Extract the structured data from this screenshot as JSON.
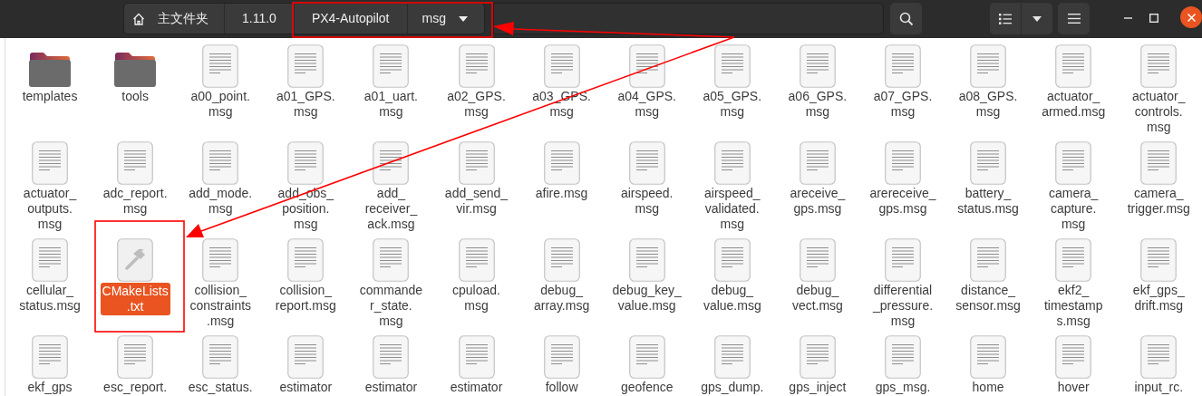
{
  "toolbar": {
    "breadcrumbs": [
      {
        "label": "主文件夹",
        "kind": "home"
      },
      {
        "label": "1.11.0",
        "kind": "plain"
      },
      {
        "label": "PX4-Autopilot",
        "kind": "plain"
      },
      {
        "label": "msg",
        "kind": "dropdown"
      }
    ]
  },
  "files": [
    {
      "kind": "folder",
      "lines": [
        "templates"
      ],
      "selected": false
    },
    {
      "kind": "folder",
      "lines": [
        "tools"
      ],
      "selected": false
    },
    {
      "kind": "text",
      "lines": [
        "a00_point.",
        "msg"
      ],
      "selected": false
    },
    {
      "kind": "text",
      "lines": [
        "a01_GPS.",
        "msg"
      ],
      "selected": false
    },
    {
      "kind": "text",
      "lines": [
        "a01_uart.",
        "msg"
      ],
      "selected": false
    },
    {
      "kind": "text",
      "lines": [
        "a02_GPS.",
        "msg"
      ],
      "selected": false
    },
    {
      "kind": "text",
      "lines": [
        "a03_GPS.",
        "msg"
      ],
      "selected": false
    },
    {
      "kind": "text",
      "lines": [
        "a04_GPS.",
        "msg"
      ],
      "selected": false
    },
    {
      "kind": "text",
      "lines": [
        "a05_GPS.",
        "msg"
      ],
      "selected": false
    },
    {
      "kind": "text",
      "lines": [
        "a06_GPS.",
        "msg"
      ],
      "selected": false
    },
    {
      "kind": "text",
      "lines": [
        "a07_GPS.",
        "msg"
      ],
      "selected": false
    },
    {
      "kind": "text",
      "lines": [
        "a08_GPS.",
        "msg"
      ],
      "selected": false
    },
    {
      "kind": "text",
      "lines": [
        "actuator_",
        "armed.msg"
      ],
      "selected": false
    },
    {
      "kind": "text",
      "lines": [
        "actuator_",
        "controls.",
        "msg"
      ],
      "selected": false
    },
    {
      "kind": "text",
      "lines": [
        "actuator_",
        "outputs.",
        "msg"
      ],
      "selected": false
    },
    {
      "kind": "text",
      "lines": [
        "adc_report.",
        "msg"
      ],
      "selected": false
    },
    {
      "kind": "text",
      "lines": [
        "add_mode.",
        "msg"
      ],
      "selected": false
    },
    {
      "kind": "text",
      "lines": [
        "add_obs_",
        "position.",
        "msg"
      ],
      "selected": false
    },
    {
      "kind": "text",
      "lines": [
        "add_",
        "receiver_",
        "ack.msg"
      ],
      "selected": false
    },
    {
      "kind": "text",
      "lines": [
        "add_send_",
        "vir.msg"
      ],
      "selected": false
    },
    {
      "kind": "text",
      "lines": [
        "afire.msg"
      ],
      "selected": false
    },
    {
      "kind": "text",
      "lines": [
        "airspeed.",
        "msg"
      ],
      "selected": false
    },
    {
      "kind": "text",
      "lines": [
        "airspeed_",
        "validated.",
        "msg"
      ],
      "selected": false
    },
    {
      "kind": "text",
      "lines": [
        "areceive_",
        "gps.msg"
      ],
      "selected": false
    },
    {
      "kind": "text",
      "lines": [
        "arereceive_",
        "gps.msg"
      ],
      "selected": false
    },
    {
      "kind": "text",
      "lines": [
        "battery_",
        "status.msg"
      ],
      "selected": false
    },
    {
      "kind": "text",
      "lines": [
        "camera_",
        "capture.",
        "msg"
      ],
      "selected": false
    },
    {
      "kind": "text",
      "lines": [
        "camera_",
        "trigger.msg"
      ],
      "selected": false
    },
    {
      "kind": "text",
      "lines": [
        "cellular_",
        "status.msg"
      ],
      "selected": false
    },
    {
      "kind": "build",
      "lines": [
        "CMakeLists",
        ".txt"
      ],
      "selected": true
    },
    {
      "kind": "text",
      "lines": [
        "collision_",
        "constraints",
        ".msg"
      ],
      "selected": false
    },
    {
      "kind": "text",
      "lines": [
        "collision_",
        "report.msg"
      ],
      "selected": false
    },
    {
      "kind": "text",
      "lines": [
        "commande",
        "r_state.",
        "msg"
      ],
      "selected": false
    },
    {
      "kind": "text",
      "lines": [
        "cpuload.",
        "msg"
      ],
      "selected": false
    },
    {
      "kind": "text",
      "lines": [
        "debug_",
        "array.msg"
      ],
      "selected": false
    },
    {
      "kind": "text",
      "lines": [
        "debug_key_",
        "value.msg"
      ],
      "selected": false
    },
    {
      "kind": "text",
      "lines": [
        "debug_",
        "value.msg"
      ],
      "selected": false
    },
    {
      "kind": "text",
      "lines": [
        "debug_",
        "vect.msg"
      ],
      "selected": false
    },
    {
      "kind": "text",
      "lines": [
        "differential",
        "_pressure.",
        "msg"
      ],
      "selected": false
    },
    {
      "kind": "text",
      "lines": [
        "distance_",
        "sensor.msg"
      ],
      "selected": false
    },
    {
      "kind": "text",
      "lines": [
        "ekf2_",
        "timestamp",
        "s.msg"
      ],
      "selected": false
    },
    {
      "kind": "text",
      "lines": [
        "ekf_gps_",
        "drift.msg"
      ],
      "selected": false
    },
    {
      "kind": "text",
      "lines": [
        "ekf_gps"
      ],
      "selected": false
    },
    {
      "kind": "text",
      "lines": [
        "esc_report."
      ],
      "selected": false
    },
    {
      "kind": "text",
      "lines": [
        "esc_status."
      ],
      "selected": false
    },
    {
      "kind": "text",
      "lines": [
        "estimator"
      ],
      "selected": false
    },
    {
      "kind": "text",
      "lines": [
        "estimator"
      ],
      "selected": false
    },
    {
      "kind": "text",
      "lines": [
        "estimator"
      ],
      "selected": false
    },
    {
      "kind": "text",
      "lines": [
        "follow"
      ],
      "selected": false
    },
    {
      "kind": "text",
      "lines": [
        "geofence"
      ],
      "selected": false
    },
    {
      "kind": "text",
      "lines": [
        "gps_dump."
      ],
      "selected": false
    },
    {
      "kind": "text",
      "lines": [
        "gps_inject"
      ],
      "selected": false
    },
    {
      "kind": "text",
      "lines": [
        "gps_msg."
      ],
      "selected": false
    },
    {
      "kind": "text",
      "lines": [
        "home"
      ],
      "selected": false
    },
    {
      "kind": "text",
      "lines": [
        "hover"
      ],
      "selected": false
    },
    {
      "kind": "text",
      "lines": [
        "input_rc."
      ],
      "selected": false
    }
  ]
}
